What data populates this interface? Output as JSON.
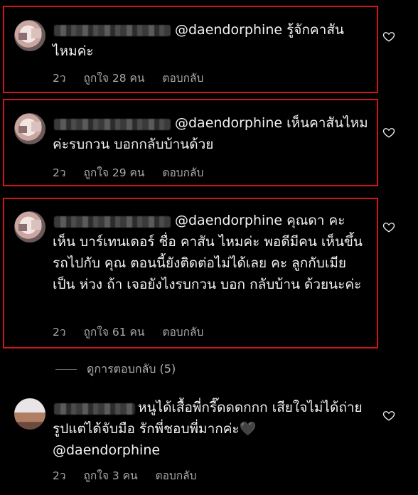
{
  "comments": [
    {
      "mention": "@daendorphine",
      "text": "รู้จักคาสันไหมค่ะ",
      "time": "2ว",
      "likes": "ถูกใจ 28 คน",
      "reply": "ตอบกลับ"
    },
    {
      "mention": "@daendorphine",
      "text": "เห็นคาสันไหมค่ะรบกวน บอกกลับบ้านด้วย",
      "time": "2ว",
      "likes": "ถูกใจ 29 คน",
      "reply": "ตอบกลับ"
    },
    {
      "mention": "@daendorphine",
      "text": "คุณดา คะ เห็น บาร์เทนเดอร์ ชื่อ คาสัน ไหมค่ะ พอดีมีคน เห็นขึ้นรถไปกับ คุณ ตอนนี้ยังติดต่อไม่ได้เลย คะ ลูกกับเมีย เป็น ห่วง ถ้า เจอยังไงรบกวน บอก กลับบ้าน ด้วยนะค่ะ",
      "time": "2ว",
      "likes": "ถูกใจ 61 คน",
      "reply": "ตอบกลับ"
    },
    {
      "text": "หนูได้เสื้อพี่กรี๊ดดดกกก เสียใจไม่ได้ถ่ายรูปแต่ได้จับมือ รักพี่ชอบพี่มากค่ะ🖤",
      "mention_after": "@daendorphine",
      "time": "2ว",
      "likes": "ถูกใจ 3 คน",
      "reply": "ตอบกลับ"
    }
  ],
  "view_replies": "ดูการตอบกลับ (5)",
  "colors": {
    "highlight_border": "#d41414",
    "background": "#000000",
    "meta": "#a8a8a8"
  }
}
